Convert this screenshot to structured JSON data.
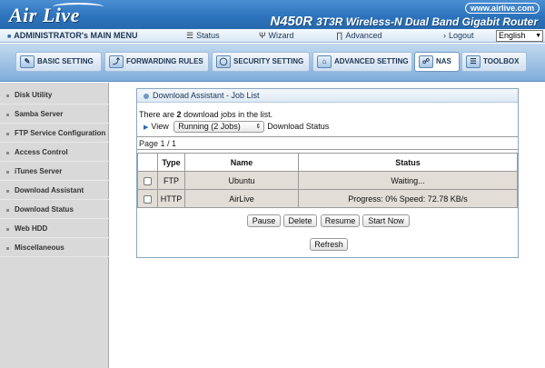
{
  "header": {
    "logo_text": "Air Live",
    "site_url": "www.airlive.com",
    "model": "N450R",
    "description": "3T3R Wireless-N Dual Band Gigabit Router"
  },
  "menu": {
    "admin_title": "ADMINISTRATOR's MAIN MENU",
    "status": "Status",
    "wizard": "Wizard",
    "advanced": "Advanced",
    "logout": "Logout",
    "language": "English"
  },
  "tabs": [
    {
      "label": "BASIC SETTING",
      "icon": "basic-setting-icon"
    },
    {
      "label": "FORWARDING RULES",
      "icon": "forwarding-rules-icon"
    },
    {
      "label": "SECURITY SETTING",
      "icon": "security-setting-icon"
    },
    {
      "label": "ADVANCED SETTING",
      "icon": "advanced-setting-icon"
    },
    {
      "label": "NAS",
      "icon": "nas-icon"
    },
    {
      "label": "TOOLBOX",
      "icon": "toolbox-icon"
    }
  ],
  "sidebar": {
    "items": [
      {
        "label": "Disk Utility"
      },
      {
        "label": "Samba Server"
      },
      {
        "label": "FTP Service Configuration"
      },
      {
        "label": "Access Control"
      },
      {
        "label": "iTunes Server"
      },
      {
        "label": "Download Assistant"
      },
      {
        "label": "Download Status"
      },
      {
        "label": "Web HDD"
      },
      {
        "label": "Miscellaneous"
      }
    ]
  },
  "panel": {
    "title": "Download Assistant - Job List",
    "count_prefix": "There are",
    "count": "2",
    "count_suffix": "download jobs in the list.",
    "view_label": "View",
    "view_selected": "Running (2 Jobs)",
    "view_suffix": "Download Status",
    "page_label": "Page  1 / 1",
    "columns": [
      "Type",
      "Name",
      "Status"
    ],
    "rows": [
      {
        "type": "FTP",
        "name": "Ubuntu",
        "status": "Waiting..."
      },
      {
        "type": "HTTP",
        "name": "AirLive",
        "status": "Progress: 0% Speed: 72.78 KB/s"
      }
    ],
    "buttons": {
      "pause": "Pause",
      "delete": "Delete",
      "resume": "Resume",
      "start_now": "Start Now",
      "refresh": "Refresh"
    }
  }
}
